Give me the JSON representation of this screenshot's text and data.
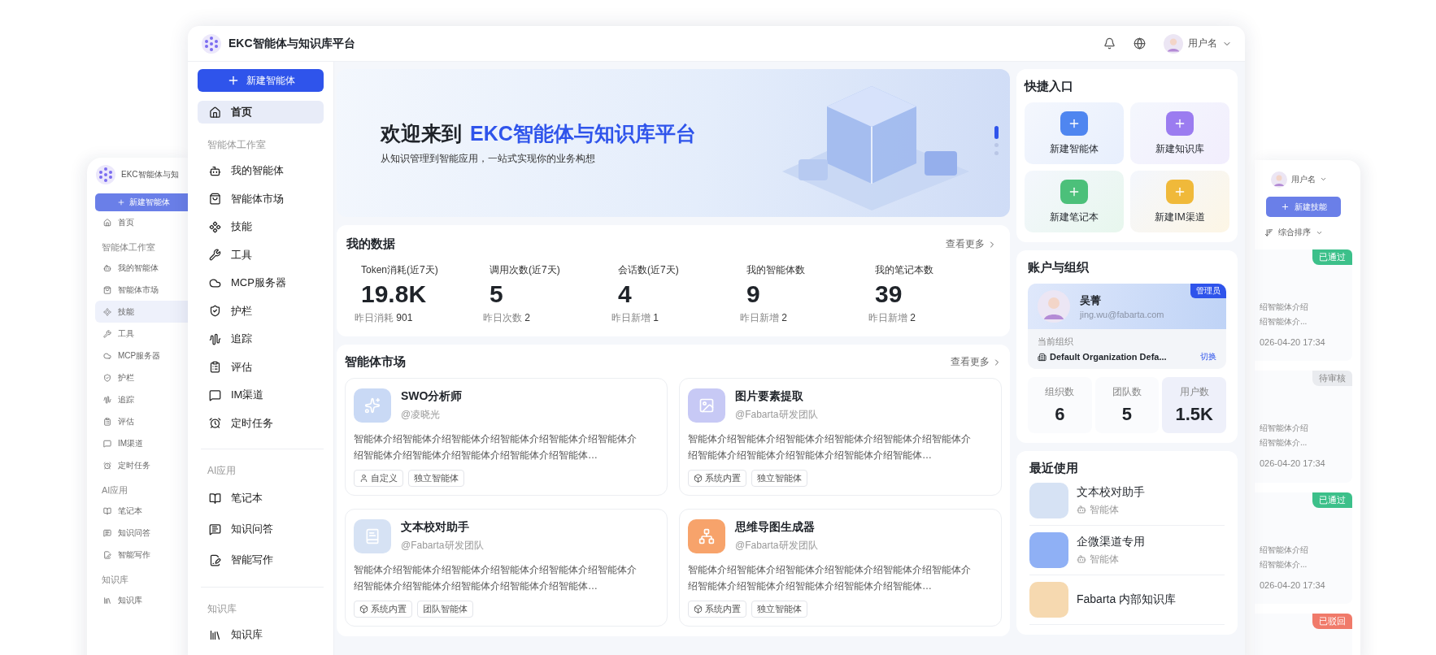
{
  "back_left": {
    "title": "EKC智能体与知",
    "new_button": "新建智能体",
    "sections": [
      {
        "items": [
          {
            "label": "首页",
            "selected": false
          }
        ]
      },
      {
        "heading": "智能体工作室",
        "items": [
          {
            "label": "我的智能体",
            "selected": false
          },
          {
            "label": "智能体市场",
            "selected": false
          },
          {
            "label": "技能",
            "selected": true
          },
          {
            "label": "工具",
            "selected": false
          },
          {
            "label": "MCP服务器",
            "selected": false
          },
          {
            "label": "护栏",
            "selected": false
          },
          {
            "label": "追踪",
            "selected": false
          },
          {
            "label": "评估",
            "selected": false
          },
          {
            "label": "IM渠道",
            "selected": false
          },
          {
            "label": "定时任务",
            "selected": false
          }
        ]
      },
      {
        "heading": "AI应用",
        "items": [
          {
            "label": "笔记本",
            "selected": false
          },
          {
            "label": "知识问答",
            "selected": false
          },
          {
            "label": "智能写作",
            "selected": false
          }
        ]
      },
      {
        "heading": "知识库",
        "items": [
          {
            "label": "知识库",
            "selected": false
          }
        ]
      }
    ]
  },
  "window": {
    "title": "EKC智能体与知识库平台",
    "user": "用户名"
  },
  "sidebar": {
    "new_button": "新建智能体",
    "sections": [
      {
        "items": [
          {
            "label": "首页",
            "selected": true
          }
        ]
      },
      {
        "heading": "智能体工作室",
        "items": [
          {
            "label": "我的智能体",
            "selected": false
          },
          {
            "label": "智能体市场",
            "selected": false
          },
          {
            "label": "技能",
            "selected": false
          },
          {
            "label": "工具",
            "selected": false
          },
          {
            "label": "MCP服务器",
            "selected": false
          },
          {
            "label": "护栏",
            "selected": false
          },
          {
            "label": "追踪",
            "selected": false
          },
          {
            "label": "评估",
            "selected": false
          },
          {
            "label": "IM渠道",
            "selected": false
          },
          {
            "label": "定时任务",
            "selected": false
          }
        ]
      },
      {
        "heading": "AI应用",
        "items": [
          {
            "label": "笔记本",
            "selected": false
          },
          {
            "label": "知识问答",
            "selected": false
          },
          {
            "label": "智能写作",
            "selected": false
          }
        ]
      },
      {
        "heading": "知识库",
        "items": [
          {
            "label": "知识库",
            "selected": false
          }
        ]
      }
    ]
  },
  "banner": {
    "title_lead": "欢迎来到",
    "title_highlight": "EKC智能体与知识库平台",
    "subtitle": "从知识管理到智能应用，一站式实现你的业务构想",
    "slides": [
      {
        "selected": true
      },
      {
        "selected": false
      },
      {
        "selected": false
      }
    ]
  },
  "my_data": {
    "title": "我的数据",
    "more": "查看更多",
    "stats": [
      {
        "label": "Token消耗(近7天)",
        "value": "19.8K",
        "sub_label": "昨日消耗",
        "sub_value": "901"
      },
      {
        "label": "调用次数(近7天)",
        "value": "5",
        "sub_label": "昨日次数",
        "sub_value": "2"
      },
      {
        "label": "会话数(近7天)",
        "value": "4",
        "sub_label": "昨日新增",
        "sub_value": "1"
      },
      {
        "label": "我的智能体数",
        "value": "9",
        "sub_label": "昨日新增",
        "sub_value": "2"
      },
      {
        "label": "我的笔记本数",
        "value": "39",
        "sub_label": "昨日新增",
        "sub_value": "2"
      }
    ]
  },
  "market": {
    "title": "智能体市场",
    "more": "查看更多",
    "cards": [
      {
        "name": "SWO分析师",
        "author": "@凌晓光",
        "color": "#c9d9f5",
        "description": "智能体介绍智能体介绍智能体介绍智能体介绍智能体介绍智能体介绍智能体介绍智能体介绍智能体介绍智能体介绍智能体…",
        "tags": [
          {
            "label": "自定义",
            "kind": "user"
          },
          {
            "label": "独立智能体",
            "kind": "plain"
          }
        ]
      },
      {
        "name": "图片要素提取",
        "author": "@Fabarta研发团队",
        "color": "#c7c9f5",
        "description": "智能体介绍智能体介绍智能体介绍智能体介绍智能体介绍智能体介绍智能体介绍智能体介绍智能体介绍智能体介绍智能体…",
        "tags": [
          {
            "label": "系统内置",
            "kind": "system"
          },
          {
            "label": "独立智能体",
            "kind": "plain"
          }
        ]
      },
      {
        "name": "文本校对助手",
        "author": "@Fabarta研发团队",
        "color": "#d6e2f4",
        "description": "智能体介绍智能体介绍智能体介绍智能体介绍智能体介绍智能体介绍智能体介绍智能体介绍智能体介绍智能体介绍智能体…",
        "tags": [
          {
            "label": "系统内置",
            "kind": "system"
          },
          {
            "label": "团队智能体",
            "kind": "plain"
          }
        ]
      },
      {
        "name": "思维导图生成器",
        "author": "@Fabarta研发团队",
        "color": "#f7a36b",
        "description": "智能体介绍智能体介绍智能体介绍智能体介绍智能体介绍智能体介绍智能体介绍智能体介绍智能体介绍智能体介绍智能体…",
        "tags": [
          {
            "label": "系统内置",
            "kind": "system"
          },
          {
            "label": "独立智能体",
            "kind": "plain"
          }
        ]
      }
    ]
  },
  "quick_entry": {
    "title": "快捷入口",
    "items": [
      {
        "label": "新建智能体",
        "color": "#4f86f0"
      },
      {
        "label": "新建知识库",
        "color": "#9b7cf0"
      },
      {
        "label": "新建笔记本",
        "color": "#4cc07a"
      },
      {
        "label": "新建IM渠道",
        "color": "#f0b93a"
      }
    ]
  },
  "account": {
    "title": "账户与组织",
    "name": "吴菁",
    "email": "jing.wu@fabarta.com",
    "role": "管理员",
    "org_label": "当前组织",
    "org_name": "Default Organization Defa...",
    "switch": "切换",
    "stats": [
      {
        "label": "组织数",
        "value": "6",
        "highlighted": false
      },
      {
        "label": "团队数",
        "value": "5",
        "highlighted": false
      },
      {
        "label": "用户数",
        "value": "1.5K",
        "highlighted": true
      }
    ]
  },
  "recent": {
    "title": "最近使用",
    "items": [
      {
        "name": "文本校对助手",
        "type": "智能体",
        "color": "#d6e2f4"
      },
      {
        "name": "企微渠道专用",
        "type": "智能体",
        "color": "#8fb0f5"
      },
      {
        "name": "Fabarta 内部知识库",
        "color": "#f6d9b0"
      }
    ]
  },
  "back_right": {
    "user": "用户名",
    "new_button": "新建技能",
    "sort": "综合排序",
    "cards": [
      {
        "status": "已通过",
        "kind": "approved",
        "line_1": "绍智能体介绍",
        "line_2": "绍智能体介...",
        "date": "026-04-20 17:34"
      },
      {
        "status": "待审核",
        "kind": "pending",
        "line_1": "绍智能体介绍",
        "line_2": "绍智能体介...",
        "date": "026-04-20 17:34"
      },
      {
        "status": "已通过",
        "kind": "approved",
        "line_1": "绍智能体介绍",
        "line_2": "绍智能体介...",
        "date": "026-04-20 17:34"
      },
      {
        "status": "已驳回",
        "kind": "rejected"
      }
    ]
  }
}
